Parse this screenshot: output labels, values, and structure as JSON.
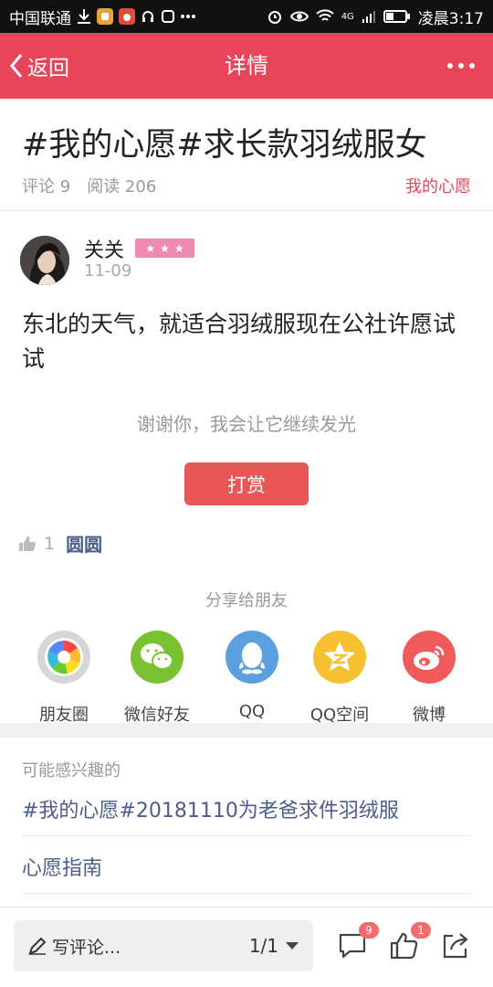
{
  "status_bar": {
    "carrier": "中国联通",
    "network": "4G",
    "time": "凌晨3:17"
  },
  "nav": {
    "back_label": "返回",
    "title": "详情"
  },
  "post": {
    "title": "#我的心愿#求长款羽绒服女",
    "comments_label": "评论 9",
    "reads_label": "阅读 206",
    "topic": "我的心愿",
    "author": "关关",
    "date": "11-09",
    "body": "东北的天气，就适合羽绒服现在公社许愿试试",
    "thanks": "谢谢你，我会让它继续发光",
    "reward_button": "打赏",
    "like_count": "1",
    "liker": "圆圆"
  },
  "share": {
    "title": "分享给朋友",
    "targets": [
      {
        "label": "朋友圈",
        "icon": "moments-icon",
        "color": "#d0d0d0"
      },
      {
        "label": "微信好友",
        "icon": "wechat-icon",
        "color": "#7bc232"
      },
      {
        "label": "QQ",
        "icon": "qq-icon",
        "color": "#5b9fe0"
      },
      {
        "label": "QQ空间",
        "icon": "qzone-icon",
        "color": "#f6c030"
      },
      {
        "label": "微博",
        "icon": "weibo-icon",
        "color": "#f05a5a"
      }
    ]
  },
  "related": {
    "label": "可能感兴趣的",
    "items": [
      "#我的心愿#20181110为老爸求件羽绒服",
      "心愿指南"
    ]
  },
  "bottom_bar": {
    "comment_placeholder": "写评论...",
    "page_indicator": "1/1",
    "comment_badge": "9",
    "like_badge": "1"
  },
  "colors": {
    "brand": "#e8445a",
    "reward": "#e85656",
    "link": "#4a5e8c"
  }
}
